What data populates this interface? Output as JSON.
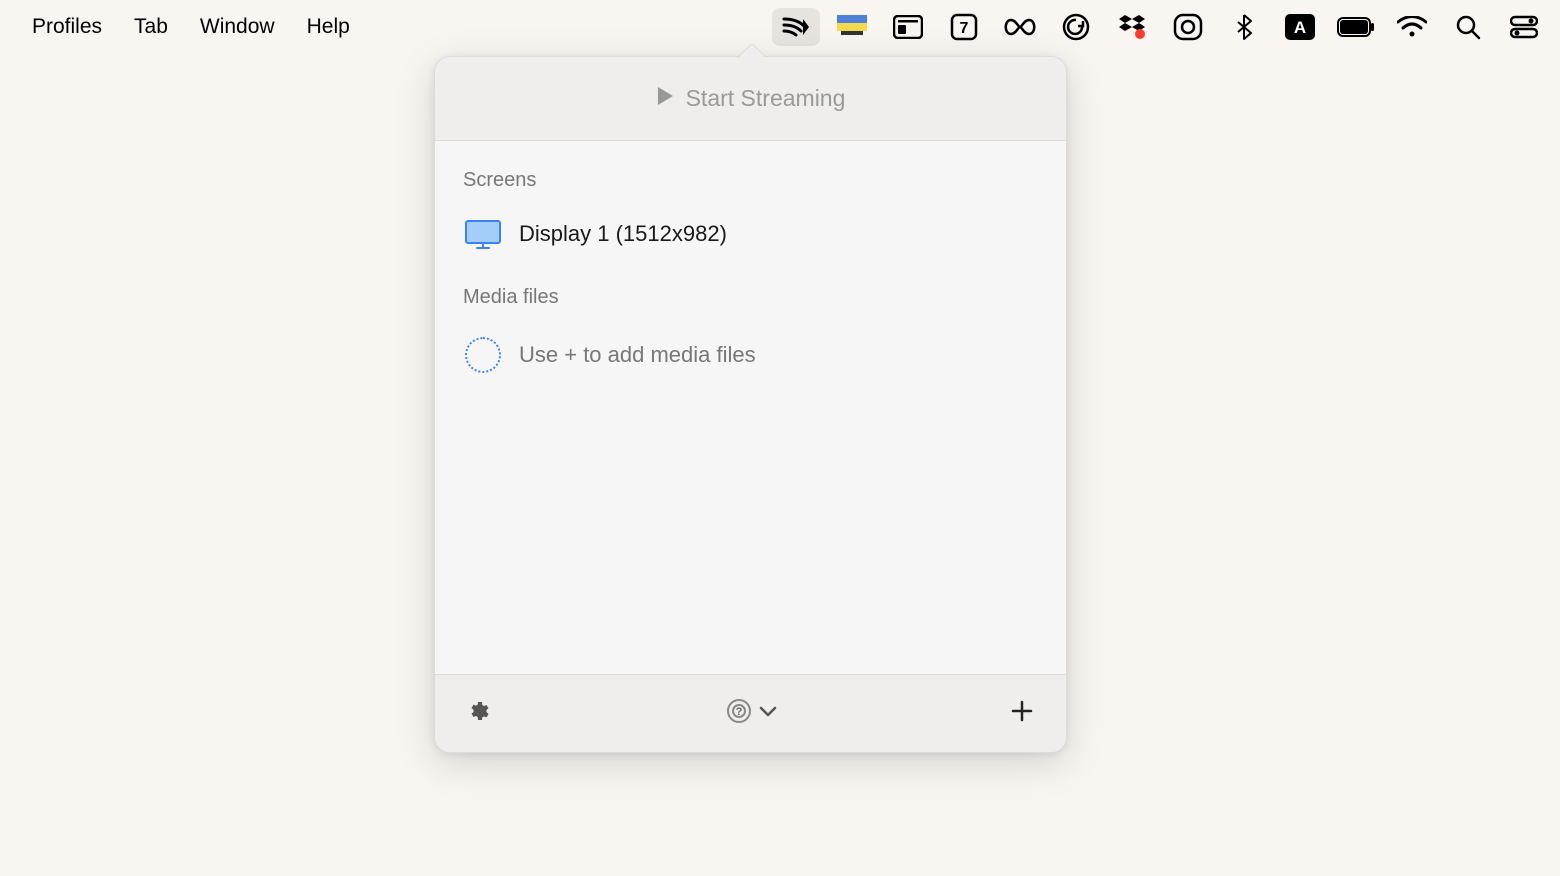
{
  "menubar": {
    "items": [
      "Profiles",
      "Tab",
      "Window",
      "Help"
    ],
    "status_icons": [
      "cast-icon",
      "flag-icon",
      "app-window-icon",
      "calendar-7-icon",
      "infinity-icon",
      "grammarly-icon",
      "dropbox-icon",
      "record-icon",
      "bluetooth-icon",
      "input-a-icon",
      "battery-icon",
      "wifi-icon",
      "search-icon",
      "control-center-icon"
    ]
  },
  "popover": {
    "header": {
      "button_label": "Start Streaming",
      "icon": "play-icon"
    },
    "sections": {
      "screens": {
        "label": "Screens",
        "items": [
          {
            "icon": "monitor-icon",
            "label": "Display 1 (1512x982)"
          }
        ]
      },
      "media_files": {
        "label": "Media files",
        "placeholder": "Use + to add media files",
        "placeholder_icon": "dotted-circle-icon"
      }
    },
    "footer": {
      "settings_icon": "gear-icon",
      "target_icon": "target-help-icon",
      "dropdown_icon": "chevron-down-icon",
      "add_icon": "plus-icon"
    }
  },
  "colors": {
    "bg": "#f9f6f2",
    "popover_bg": "#f6f6f6",
    "header_bg": "#efeeed",
    "accent": "#3b82f6"
  }
}
